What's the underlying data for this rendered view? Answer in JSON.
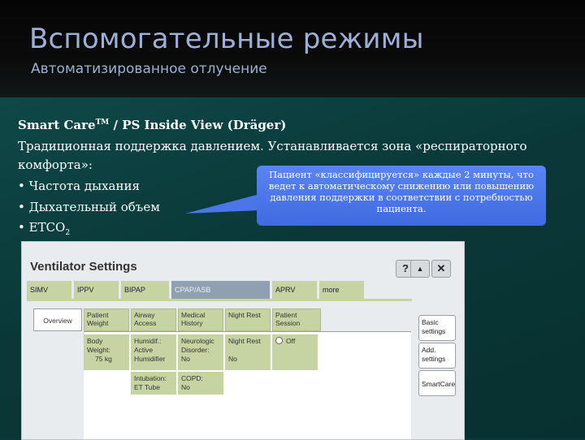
{
  "slide": {
    "title": "Вспомогательные режимы",
    "subtitle": "Автоматизированное отлучение",
    "heading": "Smart Care",
    "heading_tm": "TM",
    "heading_rest": " / PS Inside View (Dräger)",
    "line1": "Традиционная поддержка давлением. Устанавливается зона «респираторного",
    "line2": "комфорта»:",
    "bullets": [
      "• Частота дыхания",
      "• Дыхательный объем",
      "• ETCO"
    ],
    "etco_sub": "2",
    "callout": "Пациент «классифицируется» каждые 2 минуты, что ведет к автоматическому снижению или повышению давления поддержки в соответствии с потребностью пациента.",
    "colors": {
      "title": "#9db0d8",
      "callout": "#4a76ea",
      "tab_green": "#c5d4a0"
    }
  },
  "ventilator": {
    "title": "Ventilator Settings",
    "icons": [
      "help-icon",
      "up-arrow-icon",
      "close-icon"
    ],
    "help": "?",
    "up": "▲",
    "close": "✕",
    "modes": [
      "SIMV",
      "IPPV",
      "BIPAP",
      "CPAP/ASB",
      "APRV",
      "more"
    ],
    "active_mode": "CPAP/ASB",
    "tabs": {
      "overview": "Overview",
      "patient_weight": "Patient Weight",
      "airway_access": "Airway Access",
      "medical_history": "Medical History",
      "night_rest": "Night Rest",
      "patient_session": "Patient Session"
    },
    "cells": {
      "body_weight_label": "Body Weight:",
      "body_weight_value": "75  kg",
      "humidif_label": "Humidif.:",
      "humidif_value": "Active Humidifier",
      "neuro_label": "Neurologic Disorder:",
      "neuro_value": "No",
      "night_rest_label": "Night Rest",
      "night_rest_value": "No",
      "session_value": "Off",
      "intubation_label": "Intubation:",
      "intubation_value": "ET Tube",
      "copd_label": "COPD:",
      "copd_value": "No"
    },
    "side_buttons": [
      "Basic settings",
      "Add. settings",
      "SmartCare"
    ]
  }
}
